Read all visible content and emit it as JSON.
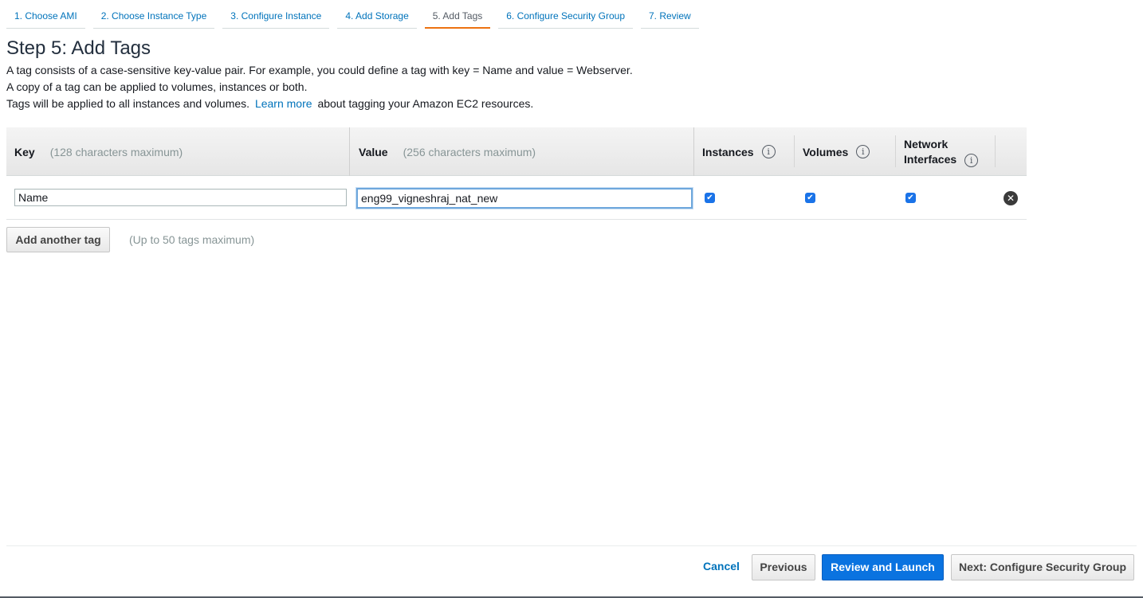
{
  "wizard": {
    "tabs": [
      {
        "label": "1. Choose AMI"
      },
      {
        "label": "2. Choose Instance Type"
      },
      {
        "label": "3. Configure Instance"
      },
      {
        "label": "4. Add Storage"
      },
      {
        "label": "5. Add Tags",
        "active": true
      },
      {
        "label": "6. Configure Security Group"
      },
      {
        "label": "7. Review"
      }
    ]
  },
  "page": {
    "title": "Step 5: Add Tags",
    "desc_line1": "A tag consists of a case-sensitive key-value pair. For example, you could define a tag with key = Name and value = Webserver.",
    "desc_line2": "A copy of a tag can be applied to volumes, instances or both.",
    "desc_line3_pre": "Tags will be applied to all instances and volumes.",
    "learn_more": "Learn more",
    "desc_line3_post": "about tagging your Amazon EC2 resources."
  },
  "table": {
    "key_header": "Key",
    "key_hint": "(128 characters maximum)",
    "value_header": "Value",
    "value_hint": "(256 characters maximum)",
    "instances_header": "Instances",
    "volumes_header": "Volumes",
    "network_header_line1": "Network",
    "network_header_line2": "Interfaces",
    "info_icon": "info-icon",
    "rows": [
      {
        "key": "Name",
        "value": "eng99_vigneshraj_nat_new",
        "instances": true,
        "volumes": true,
        "network_interfaces": true
      }
    ]
  },
  "add_tag": {
    "button": "Add another tag",
    "hint": "(Up to 50 tags maximum)"
  },
  "footer": {
    "cancel": "Cancel",
    "previous": "Previous",
    "review_launch": "Review and Launch",
    "next": "Next: Configure Security Group"
  },
  "colors": {
    "link": "#0073bb",
    "active_tab_underline": "#ec7211",
    "primary_button": "#0a73e0",
    "checkbox": "#1a73e8"
  }
}
